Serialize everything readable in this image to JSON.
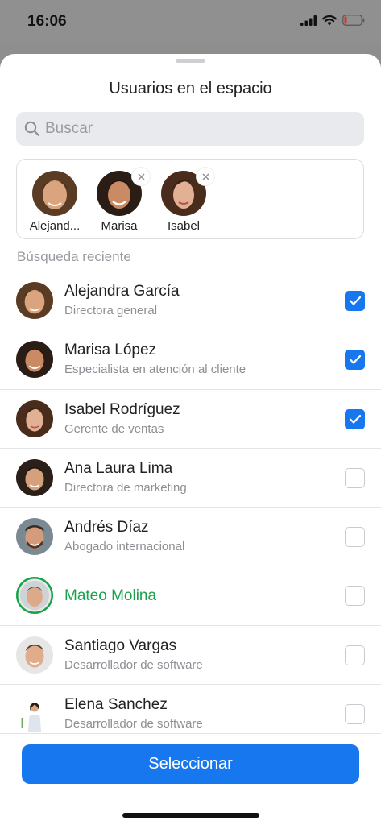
{
  "status": {
    "time": "16:06"
  },
  "sheet": {
    "title": "Usuarios en el espacio",
    "search_placeholder": "Buscar",
    "section_label": "Búsqueda reciente",
    "button_label": "Seleccionar"
  },
  "selected": [
    {
      "label": "Alejand...",
      "removable": false
    },
    {
      "label": "Marisa",
      "removable": true
    },
    {
      "label": "Isabel",
      "removable": true
    }
  ],
  "users": [
    {
      "name": "Alejandra García",
      "role": "Directora general",
      "checked": true
    },
    {
      "name": "Marisa López",
      "role": "Especialista en atención al cliente",
      "checked": true
    },
    {
      "name": "Isabel Rodríguez",
      "role": "Gerente de ventas",
      "checked": true
    },
    {
      "name": "Ana Laura Lima",
      "role": "Directora de marketing",
      "checked": false
    },
    {
      "name": "Andrés Díaz",
      "role": "Abogado internacional",
      "checked": false
    },
    {
      "name": "Mateo Molina",
      "role": "",
      "checked": false,
      "highlight": true
    },
    {
      "name": "Santiago Vargas",
      "role": "Desarrollador de software",
      "checked": false
    },
    {
      "name": "Elena Sanchez",
      "role": "Desarrollador de software",
      "checked": false
    }
  ],
  "colors": {
    "accent": "#1677ee",
    "highlight": "#1aa24a"
  }
}
